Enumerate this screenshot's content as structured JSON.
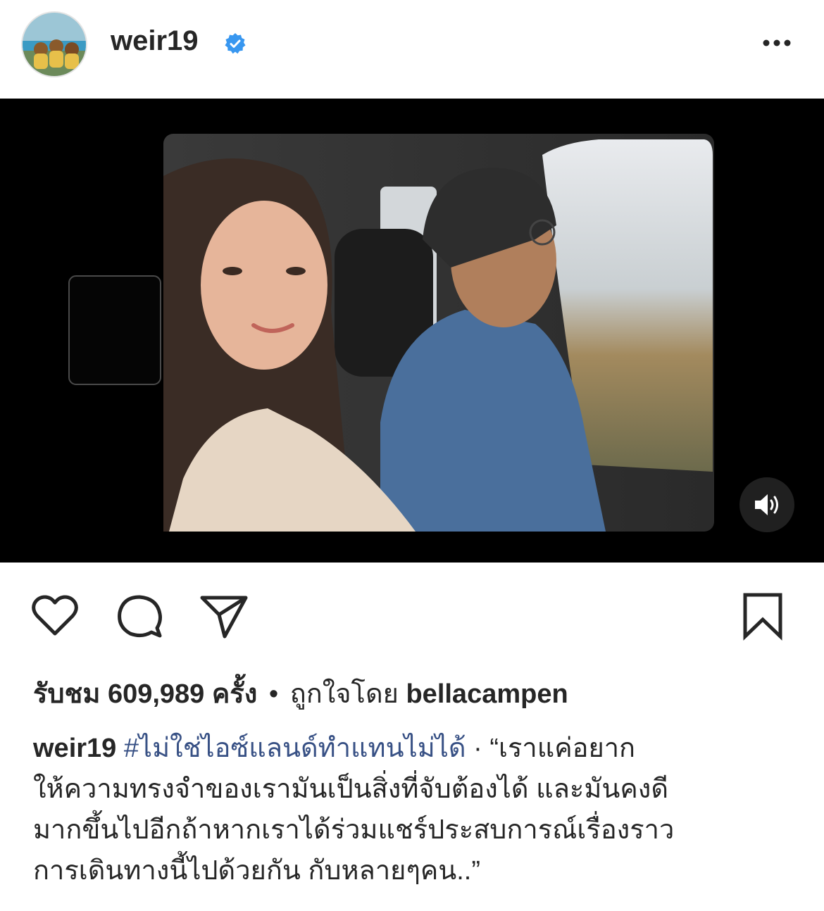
{
  "post": {
    "username": "weir19",
    "verified": true,
    "avatar_icon": "avatar-dogs",
    "more_icon": "more-icon"
  },
  "media": {
    "type": "video",
    "sound_icon": "speaker-icon"
  },
  "actions": {
    "like_icon": "heart-icon",
    "comment_icon": "comment-icon",
    "share_icon": "paper-plane-icon",
    "save_icon": "bookmark-icon"
  },
  "stats": {
    "views_prefix": "รับชม",
    "views_count": "609,989",
    "views_suffix": "ครั้ง",
    "separator": "•",
    "liked_by_prefix": "ถูกใจโดย",
    "liked_by_user": "bellacampen"
  },
  "caption": {
    "user": "weir19",
    "hashtag": "#ไม่ใช่ไอซ์แลนด์ทำแทนไม่ได้",
    "separator": "·",
    "line1_rest": "“เราแค่อยาก",
    "line2": "ให้ความทรงจำของเรามันเป็นสิ่งที่จับต้องได้ และมันคงดี",
    "line3": "มากขึ้นไปอีกถ้าหากเราได้ร่วมแชร์ประสบการณ์เรื่องราว",
    "line4": "การเดินทางนี้ไปด้วยกัน กับหลายๆคน..”"
  },
  "colors": {
    "text": "#262626",
    "hashtag": "#385185",
    "verified": "#3897f0",
    "media_bg": "#000000"
  }
}
